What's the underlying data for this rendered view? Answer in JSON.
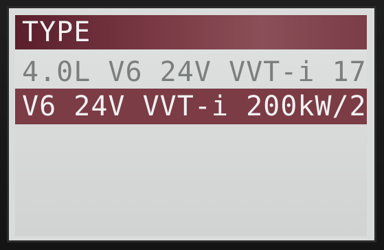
{
  "header": {
    "title": "TYPE"
  },
  "list": {
    "items": [
      {
        "label": "4.0L V6 24V VVT-i 17",
        "selected": false
      },
      {
        "label": "V6 24V VVT-i 200kW/2",
        "selected": true
      }
    ]
  },
  "colors": {
    "header_bg": "#7a3944",
    "selected_bg": "#7b3c46",
    "screen_bg": "#d9dcdb",
    "text_light": "#f2f2f2",
    "text_dim": "#7a7e7d"
  }
}
